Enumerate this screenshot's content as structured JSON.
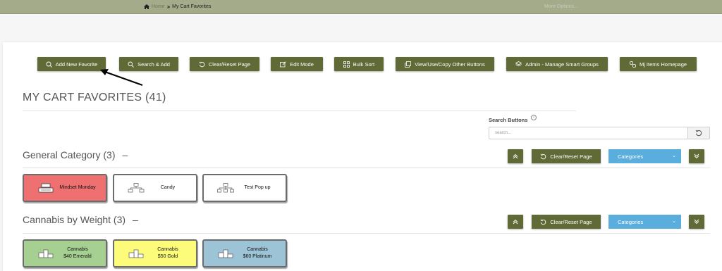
{
  "breadcrumb": {
    "home": "Home",
    "current": "My Cart Favorites"
  },
  "top_right_link": "More Options...",
  "toolbar": [
    {
      "label": "Add New Favorite",
      "icon": "add-favorite-icon"
    },
    {
      "label": "Search & Add",
      "icon": "search-icon"
    },
    {
      "label": "Clear/Reset Page",
      "icon": "reset-icon"
    },
    {
      "label": "Edit Mode",
      "icon": "edit-icon"
    },
    {
      "label": "Bulk Sort",
      "icon": "grid-icon"
    },
    {
      "label": "View/Use/Copy Other Buttons",
      "icon": "copy-icon"
    },
    {
      "label": "Admin - Manage Smart Groups",
      "icon": "layers-icon"
    },
    {
      "label": "Mj Items Homepage",
      "icon": "link-icon"
    }
  ],
  "page_title": "MY CART FAVORITES (41)",
  "search": {
    "label": "Search Buttons",
    "placeholder": "search..."
  },
  "sections": [
    {
      "title": "General Category (3)",
      "collapse_symbol": "–",
      "reset_label": "Clear/Reset Page",
      "select_value": "Categories",
      "tiles": [
        {
          "label_line1": "Mindset Monday",
          "label_line2": "",
          "color": "#ef7070",
          "icon": "register-icon"
        },
        {
          "label_line1": "Candy",
          "label_line2": "",
          "color": "#ffffff",
          "icon": "hierarchy-icon"
        },
        {
          "label_line1": "Test Pop up",
          "label_line2": "",
          "color": "#ffffff",
          "icon": "org-chart-icon"
        }
      ]
    },
    {
      "title": "Cannabis by Weight (3)",
      "collapse_symbol": "–",
      "reset_label": "Clear/Reset Page",
      "select_value": "Categories",
      "tiles": [
        {
          "label_line1": "Cannabis",
          "label_line2": "$40 Emerald",
          "color": "#a6cf92",
          "icon": "podium-icon"
        },
        {
          "label_line1": "Cannabis",
          "label_line2": "$50 Gold",
          "color": "#fcfc7a",
          "icon": "podium-icon"
        },
        {
          "label_line1": "Cannabis",
          "label_line2": "$60 Platinum",
          "color": "#9dc3d6",
          "icon": "podium-icon"
        }
      ]
    }
  ],
  "colors": {
    "accent": "#5f6a36",
    "select": "#5aaede",
    "topbar": "#a3ab8a"
  }
}
